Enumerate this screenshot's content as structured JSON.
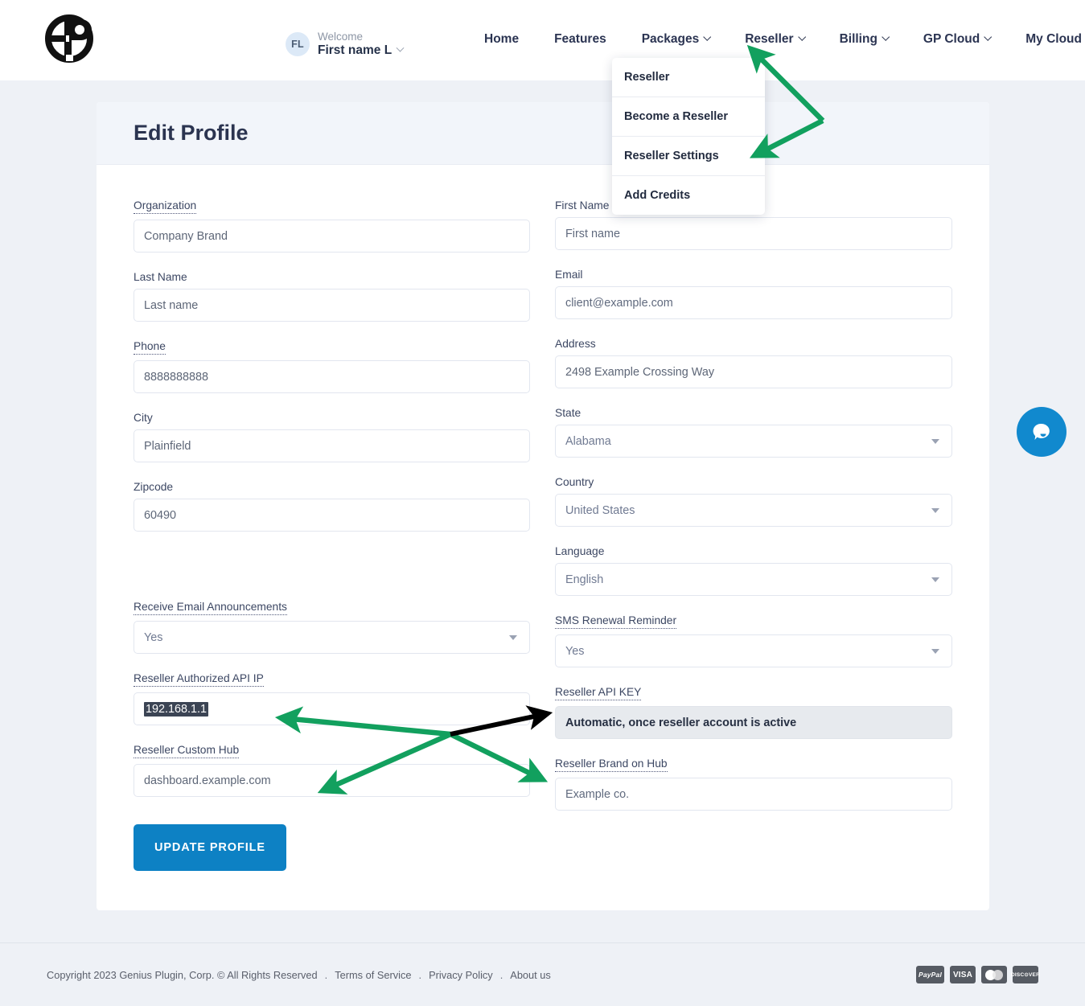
{
  "brand": {
    "logo_alt": "gp-logo"
  },
  "header": {
    "avatar_initials": "FL",
    "welcome_label": "Welcome",
    "user_name": "First name L",
    "nav": [
      {
        "label": "Home",
        "has_caret": false
      },
      {
        "label": "Features",
        "has_caret": false
      },
      {
        "label": "Packages",
        "has_caret": true
      },
      {
        "label": "Reseller",
        "has_caret": true
      },
      {
        "label": "Billing",
        "has_caret": true
      },
      {
        "label": "GP Cloud",
        "has_caret": true
      },
      {
        "label": "My Cloud",
        "has_caret": false
      }
    ]
  },
  "dropdown": {
    "open_for": "Reseller",
    "items": [
      {
        "label": "Reseller"
      },
      {
        "label": "Become a Reseller"
      },
      {
        "label": "Reseller Settings"
      },
      {
        "label": "Add Credits"
      }
    ]
  },
  "card": {
    "title": "Edit Profile",
    "left_fields": [
      {
        "label": "Organization",
        "hint": true,
        "type": "text",
        "value": "Company Brand",
        "placeholder": ""
      },
      {
        "label": "Last Name",
        "hint": false,
        "type": "text",
        "value": "Last name",
        "placeholder": "Last name"
      },
      {
        "label": "Phone",
        "hint": true,
        "type": "text",
        "value": "8888888888",
        "placeholder": ""
      },
      {
        "label": "City",
        "hint": false,
        "type": "text",
        "value": "Plainfield",
        "placeholder": ""
      },
      {
        "label": "Zipcode",
        "hint": false,
        "type": "text",
        "value": "60490",
        "placeholder": ""
      }
    ],
    "right_fields": [
      {
        "label": "First Name",
        "hint": false,
        "type": "text",
        "value": "First name",
        "placeholder": "First name"
      },
      {
        "label": "Email",
        "hint": false,
        "type": "text",
        "value": "client@example.com",
        "placeholder": "client@example.com"
      },
      {
        "label": "Address",
        "hint": false,
        "type": "text",
        "value": "2498 Example Crossing Way",
        "placeholder": ""
      },
      {
        "label": "State",
        "hint": false,
        "type": "select",
        "value": "Alabama",
        "placeholder": ""
      },
      {
        "label": "Country",
        "hint": false,
        "type": "select",
        "value": "United States",
        "placeholder": ""
      },
      {
        "label": "Language",
        "hint": false,
        "type": "select",
        "value": "English",
        "placeholder": ""
      }
    ],
    "prefs_left": {
      "label": "Receive Email Announcements",
      "hint": true,
      "type": "select",
      "value": "Yes"
    },
    "prefs_right": {
      "label": "SMS Renewal Reminder",
      "hint": true,
      "type": "select",
      "value": "Yes"
    },
    "api_ip": {
      "label": "Reseller Authorized API IP",
      "hint": true,
      "value": "192.168.1.1",
      "selected": true
    },
    "api_key": {
      "label": "Reseller API KEY",
      "hint": true,
      "value": "Automatic, once reseller account is active",
      "readonly": true
    },
    "custom_hub": {
      "label": "Reseller Custom Hub",
      "hint": true,
      "value": "dashboard.example.com"
    },
    "brand_hub": {
      "label": "Reseller Brand on Hub",
      "hint": true,
      "value": "Example co."
    },
    "submit_label": "UPDATE PROFILE"
  },
  "chat": {
    "icon": "chat-bubble-icon",
    "color": "#1189ce"
  },
  "footer": {
    "copyright": "Copyright 2023 Genius Plugin, Corp. © All Rights Reserved",
    "links": [
      {
        "label": "Terms of Service"
      },
      {
        "label": "Privacy Policy"
      },
      {
        "label": "About us"
      }
    ],
    "separator": ".",
    "payments": [
      {
        "name": "paypal-icon",
        "label": "PayPal"
      },
      {
        "name": "visa-icon",
        "label": "VISA"
      },
      {
        "name": "mastercard-icon",
        "label": "master card"
      },
      {
        "name": "discover-icon",
        "label": "DISC⊙VER"
      }
    ]
  },
  "annotations": {
    "arrow_color_green": "#12a05e",
    "arrow_color_black": "#000000",
    "count": 5
  }
}
